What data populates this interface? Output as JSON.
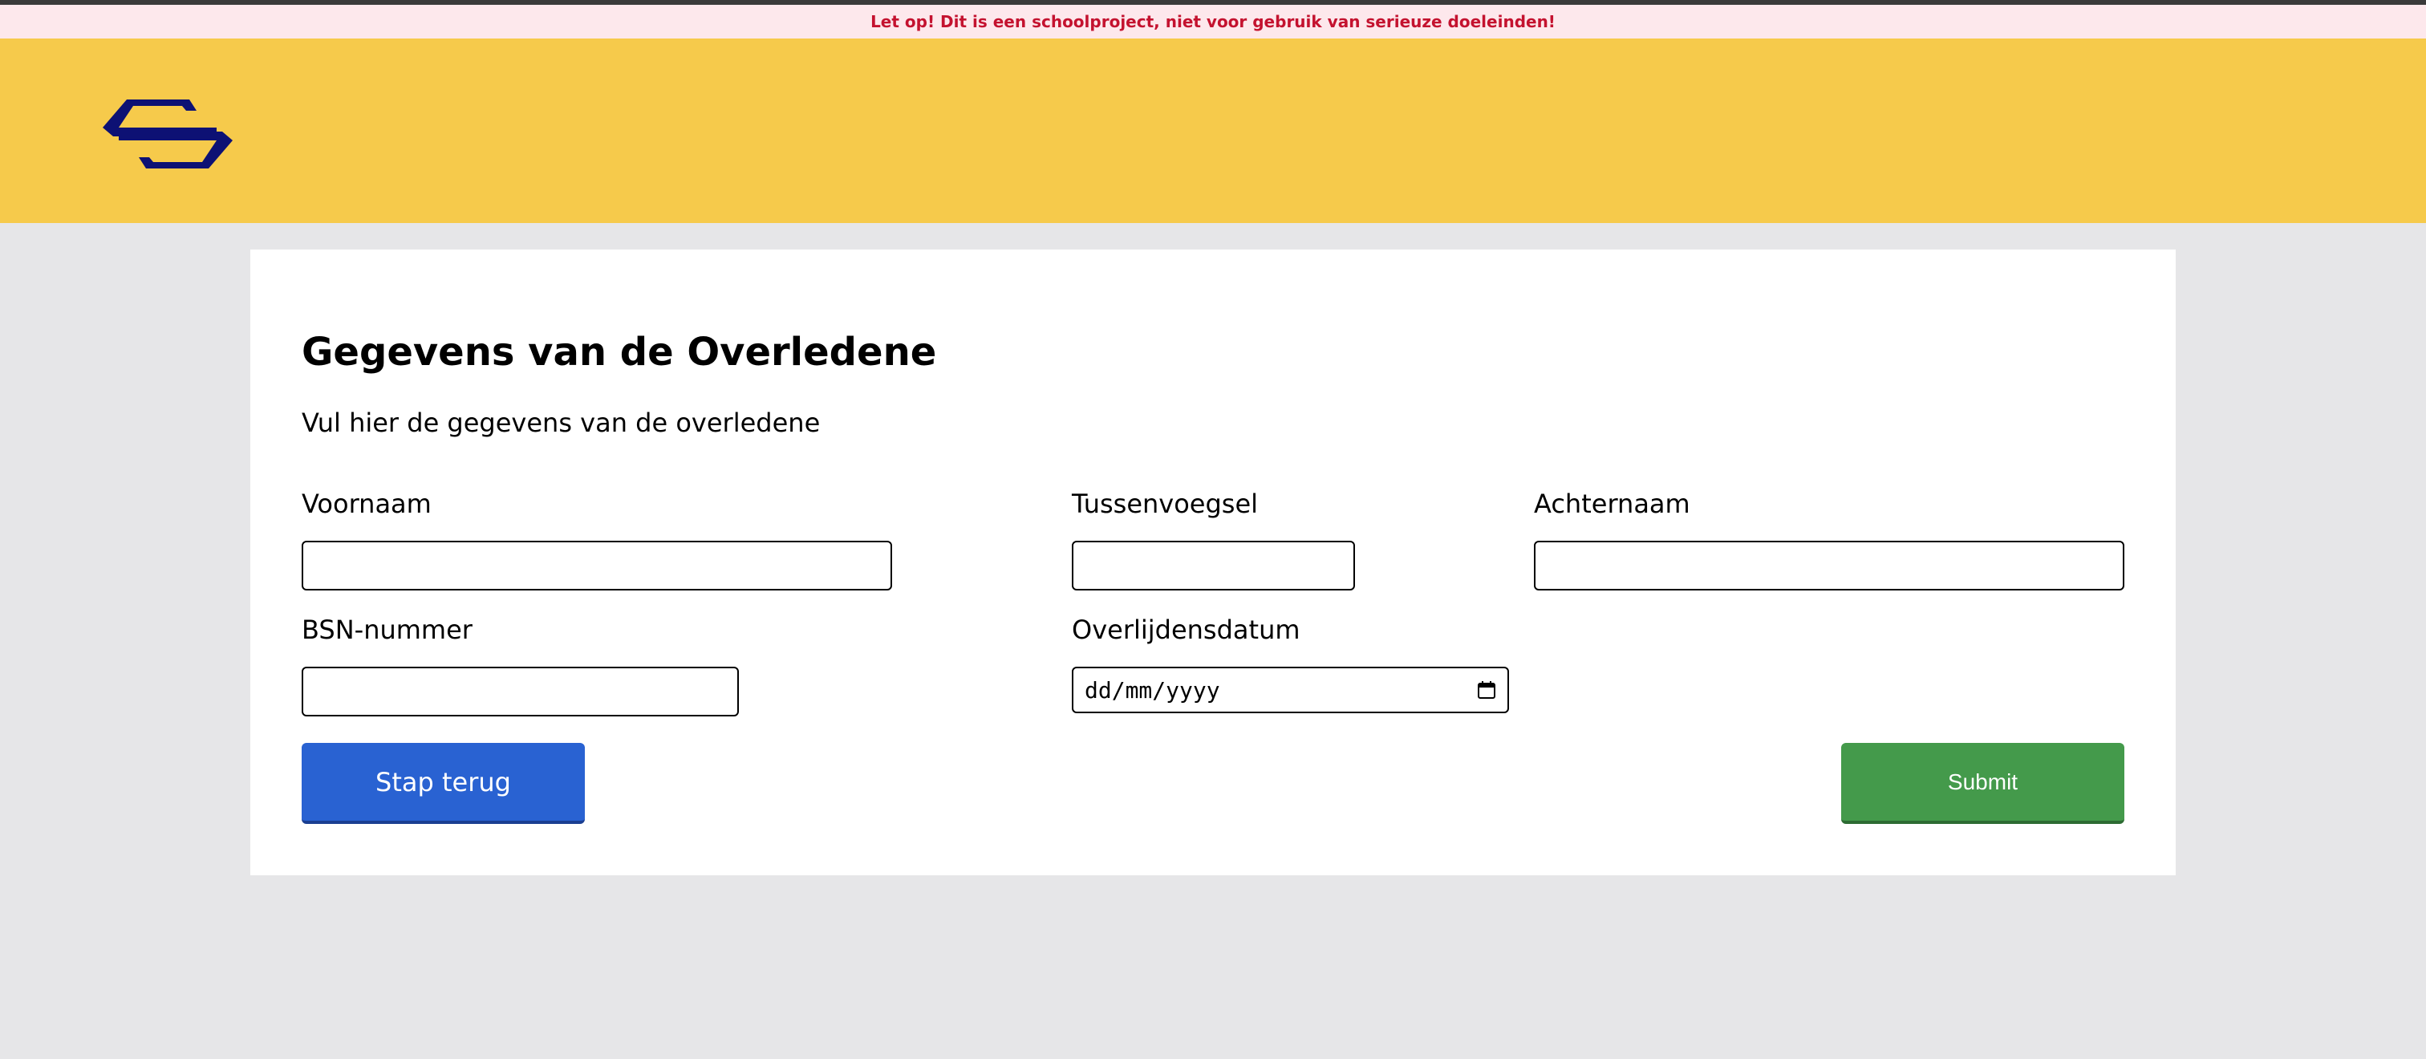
{
  "notice": {
    "text": "Let op! Dit is een schoolproject, niet voor gebruik van serieuze doeleinden!"
  },
  "header": {
    "logo_icon": "ns-logo-icon",
    "brand_color": "#f6ca4b",
    "logo_color": "#0d1174"
  },
  "form": {
    "title": "Gegevens van de Overledene",
    "subtitle": "Vul hier de gegevens van de overledene",
    "fields": {
      "voornaam": {
        "label": "Voornaam",
        "value": ""
      },
      "tussenvoegsel": {
        "label": "Tussenvoegsel",
        "value": ""
      },
      "achternaam": {
        "label": "Achternaam",
        "value": ""
      },
      "bsn": {
        "label": "BSN-nummer",
        "value": ""
      },
      "overlijdensdatum": {
        "label": "Overlijdensdatum",
        "placeholder": "dd/mm/yyyy"
      }
    },
    "buttons": {
      "back_label": "Stap terug",
      "submit_label": "Submit"
    }
  },
  "colors": {
    "back_button": "#2962d2",
    "submit_button": "#449a4b",
    "notice_text": "#c4122f",
    "background": "#e6e6e8"
  }
}
